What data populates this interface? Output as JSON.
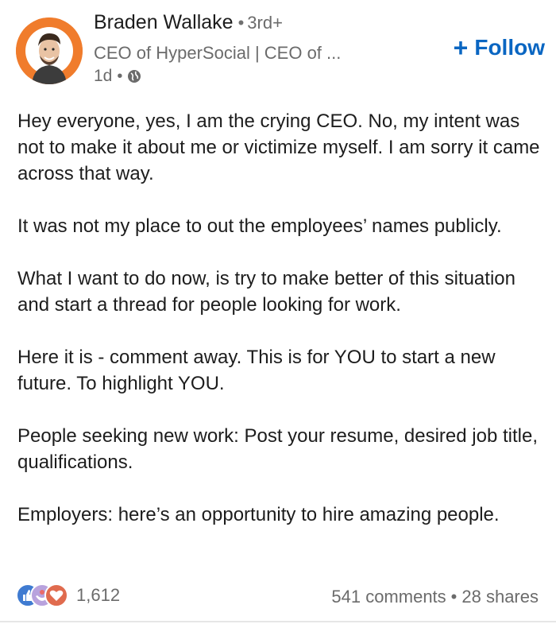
{
  "author": {
    "name": "Braden Wallake",
    "degree": "3rd+",
    "headline": "CEO of HyperSocial | CEO of ...",
    "time": "1d",
    "avatar_color": "#f07c2c"
  },
  "follow": {
    "label": "Follow",
    "color": "#0a66c2"
  },
  "paragraphs": [
    "Hey everyone, yes, I am the crying CEO. No, my intent was not to make it about me or victimize myself. I am sorry it came across that way.",
    "It was not my place to out the employees’ names publicly.",
    "What I want to do now, is try to make better of this situation and start a thread for people looking for work.",
    "Here it is - comment away. This is for YOU to start a new future. To highlight YOU.",
    "People seeking new work: Post your resume, desired job title, qualifications.",
    "Employers: here’s an opportunity to hire amazing people."
  ],
  "footer": {
    "reaction_count": "1,612",
    "comments": "541 comments",
    "shares": "28 shares",
    "reaction_icons": [
      "like-icon",
      "support-icon",
      "love-icon"
    ]
  }
}
